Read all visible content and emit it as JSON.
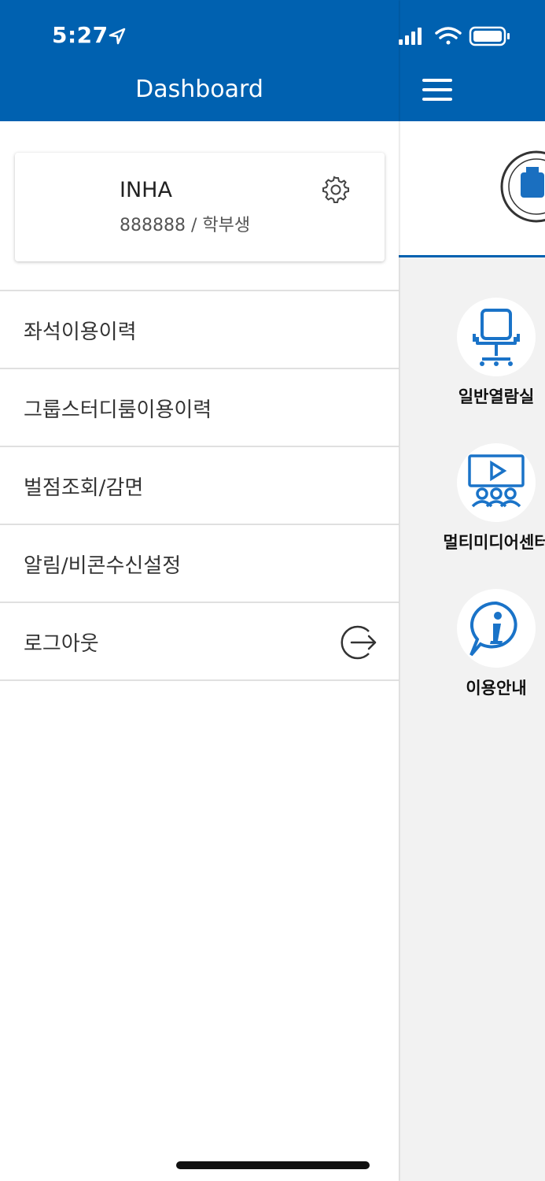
{
  "status_bar": {
    "time": "5:27"
  },
  "drawer": {
    "title": "Dashboard",
    "profile": {
      "name": "INHA",
      "id_type": "888888 / 학부생"
    },
    "menu": [
      {
        "label": "좌석이용이력"
      },
      {
        "label": "그룹스터디룸이용이력"
      },
      {
        "label": "벌점조회/감면"
      },
      {
        "label": "알림/비콘수신설정"
      },
      {
        "label": "로그아웃"
      }
    ]
  },
  "background_app": {
    "tiles": [
      {
        "label": "일반열람실",
        "icon": "chair-icon"
      },
      {
        "label": "멀티미디어센터",
        "icon": "multimedia-icon"
      },
      {
        "label": "이용안내",
        "icon": "info-icon"
      }
    ]
  },
  "colors": {
    "primary": "#0061b0",
    "background": "#f2f2f2"
  }
}
